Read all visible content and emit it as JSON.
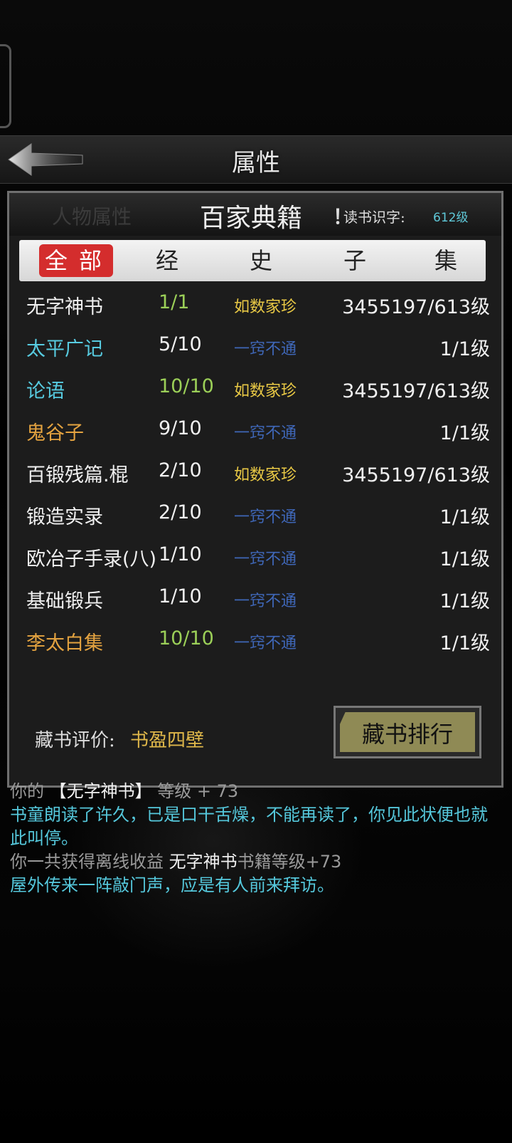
{
  "header": {
    "title": "属性"
  },
  "panel": {
    "bg_label": "人物属性",
    "title": "百家典籍",
    "title_mark": "！",
    "reading_label": "读书识字:",
    "reading_level": "612级"
  },
  "tabs": [
    {
      "label": "全部",
      "active": true
    },
    {
      "label": "经",
      "active": false
    },
    {
      "label": "史",
      "active": false
    },
    {
      "label": "子",
      "active": false
    },
    {
      "label": "集",
      "active": false
    }
  ],
  "books": [
    {
      "name": "无字神书",
      "count": "1/1",
      "status": "如数家珍",
      "level": "3455197/613级",
      "name_color": "#f0f0f0",
      "count_color": "#9bcf58",
      "status_color": "#e8c845"
    },
    {
      "name": "太平广记",
      "count": "5/10",
      "status": "一窍不通",
      "level": "1/1级",
      "name_color": "#57cbe0",
      "count_color": "#f0f0f0",
      "status_color": "#3f67b8"
    },
    {
      "name": "论语",
      "count": "10/10",
      "status": "如数家珍",
      "level": "3455197/613级",
      "name_color": "#57cbe0",
      "count_color": "#9bcf58",
      "status_color": "#e8c845"
    },
    {
      "name": "鬼谷子",
      "count": "9/10",
      "status": "一窍不通",
      "level": "1/1级",
      "name_color": "#e4a340",
      "count_color": "#f0f0f0",
      "status_color": "#3f67b8"
    },
    {
      "name": "百锻残篇.棍",
      "count": "2/10",
      "status": "如数家珍",
      "level": "3455197/613级",
      "name_color": "#f0f0f0",
      "count_color": "#f0f0f0",
      "status_color": "#e8c845"
    },
    {
      "name": "锻造实录",
      "count": "2/10",
      "status": "一窍不通",
      "level": "1/1级",
      "name_color": "#f0f0f0",
      "count_color": "#f0f0f0",
      "status_color": "#3f67b8"
    },
    {
      "name": "欧冶子手录(八)",
      "count": "1/10",
      "status": "一窍不通",
      "level": "1/1级",
      "name_color": "#f0f0f0",
      "count_color": "#f0f0f0",
      "status_color": "#3f67b8"
    },
    {
      "name": "基础锻兵",
      "count": "1/10",
      "status": "一窍不通",
      "level": "1/1级",
      "name_color": "#f0f0f0",
      "count_color": "#f0f0f0",
      "status_color": "#3f67b8"
    },
    {
      "name": "李太白集",
      "count": "10/10",
      "status": "一窍不通",
      "level": "1/1级",
      "name_color": "#e4a340",
      "count_color": "#9bcf58",
      "status_color": "#3f67b8"
    }
  ],
  "rating": {
    "label": "藏书评价:",
    "value": "书盈四壁"
  },
  "rank_button": "藏书排行",
  "log": {
    "line1": {
      "prefix": "你的",
      "book": "【无字神书】",
      "suffix": "等级 + 73"
    },
    "line2": "书童朗读了许久，已是口干舌燥，不能再读了，你见此状便也就此叫停。",
    "line3": {
      "prefix": "你一共获得离线收益 ",
      "book": "无字神书",
      "suffix": "书籍等级+73"
    },
    "line4": "屋外传来一阵敲门声，应是有人前来拜访。"
  }
}
